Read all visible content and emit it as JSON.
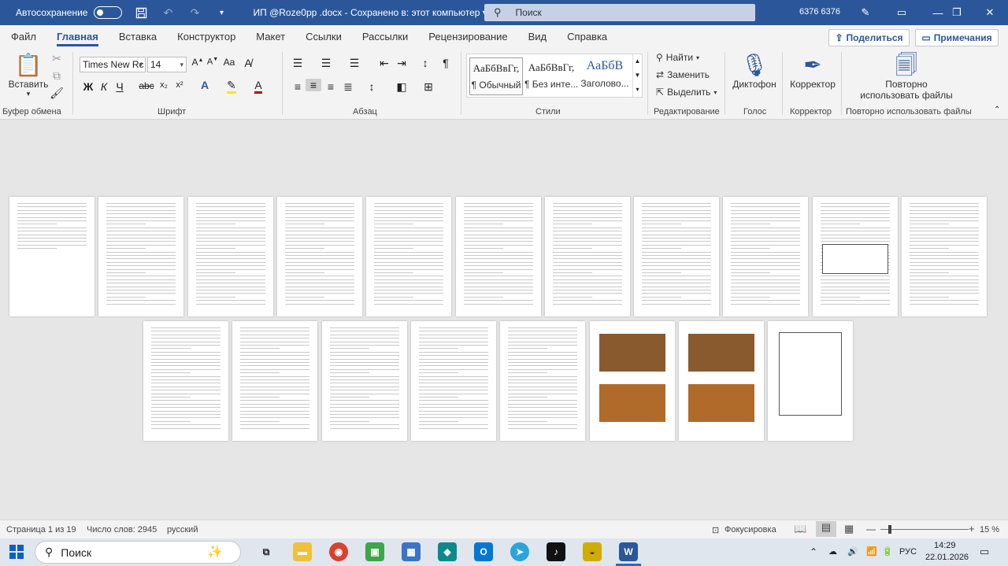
{
  "titlebar": {
    "autosave_label": "Автосохранение",
    "document_title": "ИП @Roze0pp .docx  -  Сохранено в: этот компьютер  ▾",
    "search_placeholder": "Поиск",
    "user_name": "6376 6376"
  },
  "tabs": [
    "Файл",
    "Главная",
    "Вставка",
    "Конструктор",
    "Макет",
    "Ссылки",
    "Рассылки",
    "Рецензирование",
    "Вид",
    "Справка"
  ],
  "active_tab": "Главная",
  "share_label": "Поделиться",
  "notes_label": "Примечания",
  "ribbon": {
    "paste_label": "Вставить",
    "clipboard_label": "Буфер обмена",
    "font_name": "Times New Rc",
    "font_size": "14",
    "font_label": "Шрифт",
    "paragraph_label": "Абзац",
    "styles": [
      {
        "preview": "АаБбВвГг,",
        "name": "¶ Обычный"
      },
      {
        "preview": "АаБбВвГг,",
        "name": "¶ Без инте..."
      },
      {
        "preview": "АаБбВ",
        "name": "Заголово..."
      }
    ],
    "styles_label": "Стили",
    "find_label": "Найти",
    "replace_label": "Заменить",
    "select_label": "Выделить",
    "editing_label": "Редактирование",
    "dictate_label": "Диктофон",
    "voice_label": "Голос",
    "corrector_label": "Корректор",
    "corrector_group_label": "Корректор",
    "reuse_label": "Повторно использовать файлы",
    "reuse_group_label": "Повторно использовать файлы"
  },
  "status": {
    "page": "Страница 1 из 19",
    "words": "Число слов: 2945",
    "language": "русский",
    "focus": "Фокусировка",
    "zoom": "15 %"
  },
  "taskbar": {
    "search_placeholder": "Поиск",
    "language": "РУС",
    "time": "14:29",
    "date": "22.01.2026"
  },
  "colors": {
    "accent": "#2b579a",
    "ribbon_bg": "#f3f3f3",
    "doc_bg": "#e6e6e6"
  }
}
